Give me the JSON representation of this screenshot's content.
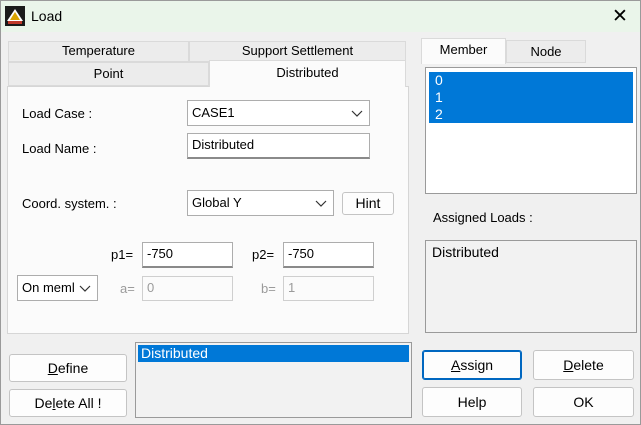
{
  "window": {
    "title": "Load",
    "close_glyph": "✕"
  },
  "tabs_left": {
    "row_top": [
      "Temperature",
      "Support Settlement"
    ],
    "row_bottom": [
      "Point",
      "Distributed"
    ],
    "active": "Distributed"
  },
  "form": {
    "load_case_label": "Load Case :",
    "load_case_value": "CASE1",
    "load_name_label": "Load Name :",
    "load_name_value": "Distributed",
    "coord_label": "Coord. system. :",
    "coord_value": "Global Y",
    "hint_button": "Hint",
    "p1_label": "p1=",
    "p1_value": "-750",
    "p2_label": "p2=",
    "p2_value": "-750",
    "position_value": "On meml",
    "a_label": "a=",
    "a_value": "0",
    "b_label": "b=",
    "b_value": "1"
  },
  "tabs_right": {
    "items": [
      "Member",
      "Node"
    ],
    "active": "Member"
  },
  "member_list": [
    "0",
    "1",
    "2"
  ],
  "assigned_loads": {
    "label": "Assigned Loads :",
    "items": [
      "Distributed"
    ]
  },
  "loads_list": [
    "Distributed"
  ],
  "buttons": {
    "define": {
      "first": "D",
      "rest": "efine"
    },
    "delete_all": {
      "pre": "De",
      "mid": "l",
      "rest": "ete All !"
    },
    "assign": {
      "first": "A",
      "rest": "ssign"
    },
    "delete": {
      "first": "D",
      "rest": "elete"
    },
    "help": "Help",
    "ok": "OK"
  },
  "colors": {
    "titlebar": "#eaf5ea",
    "selection": "#0078d7",
    "focus_border": "#0067c0"
  },
  "icons": [
    "app-logo-icon",
    "close-icon",
    "chevron-down-icon"
  ]
}
